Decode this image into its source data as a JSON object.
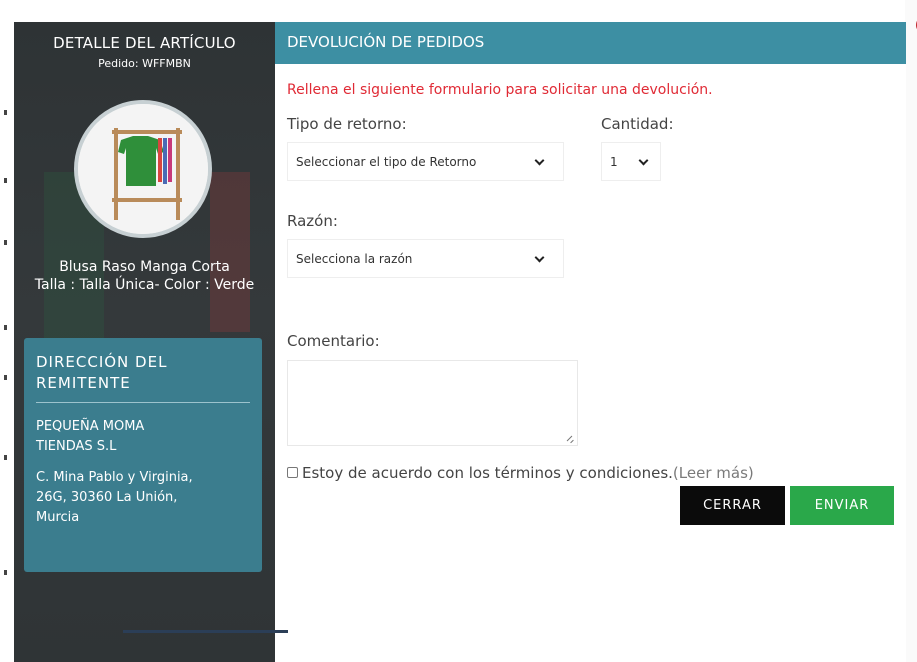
{
  "sidebar": {
    "title": "DETALLE DEL ARTÍCULO",
    "order": "Pedido: WFFMBN",
    "product": {
      "name": "Blusa Raso Manga Corta",
      "details": "Talla : Talla Única- Color : Verde"
    },
    "sender": {
      "title": "DIRECCIÓN DEL REMITENTE",
      "company_line1": "PEQUEÑA MOMA",
      "company_line2": "TIENDAS S.L",
      "address_line1": "C. Mina Pablo y Virginia,",
      "address_line2": "26G, 30360 La Unión,",
      "address_line3": "Murcia"
    }
  },
  "form": {
    "header": "DEVOLUCIÓN DE PEDIDOS",
    "intro": "Rellena el siguiente formulario para solicitar una devolución.",
    "return_type_label": "Tipo de retorno:",
    "return_type_value": "Seleccionar el tipo de Retorno",
    "quantity_label": "Cantidad:",
    "quantity_value": "1",
    "reason_label": "Razón:",
    "reason_value": "Selecciona la razón",
    "comment_label": "Comentario:",
    "terms_text": "Estoy de acuerdo con los términos y condiciones.",
    "terms_link": "(Leer más)",
    "close_button": "CERRAR",
    "send_button": "ENVIAR"
  },
  "colors": {
    "header": "#3d8fa3",
    "sender_box": "#3b7d8e",
    "intro_text": "#e02a35",
    "send_button": "#2aa84a",
    "close_button": "#0b0b0b"
  }
}
